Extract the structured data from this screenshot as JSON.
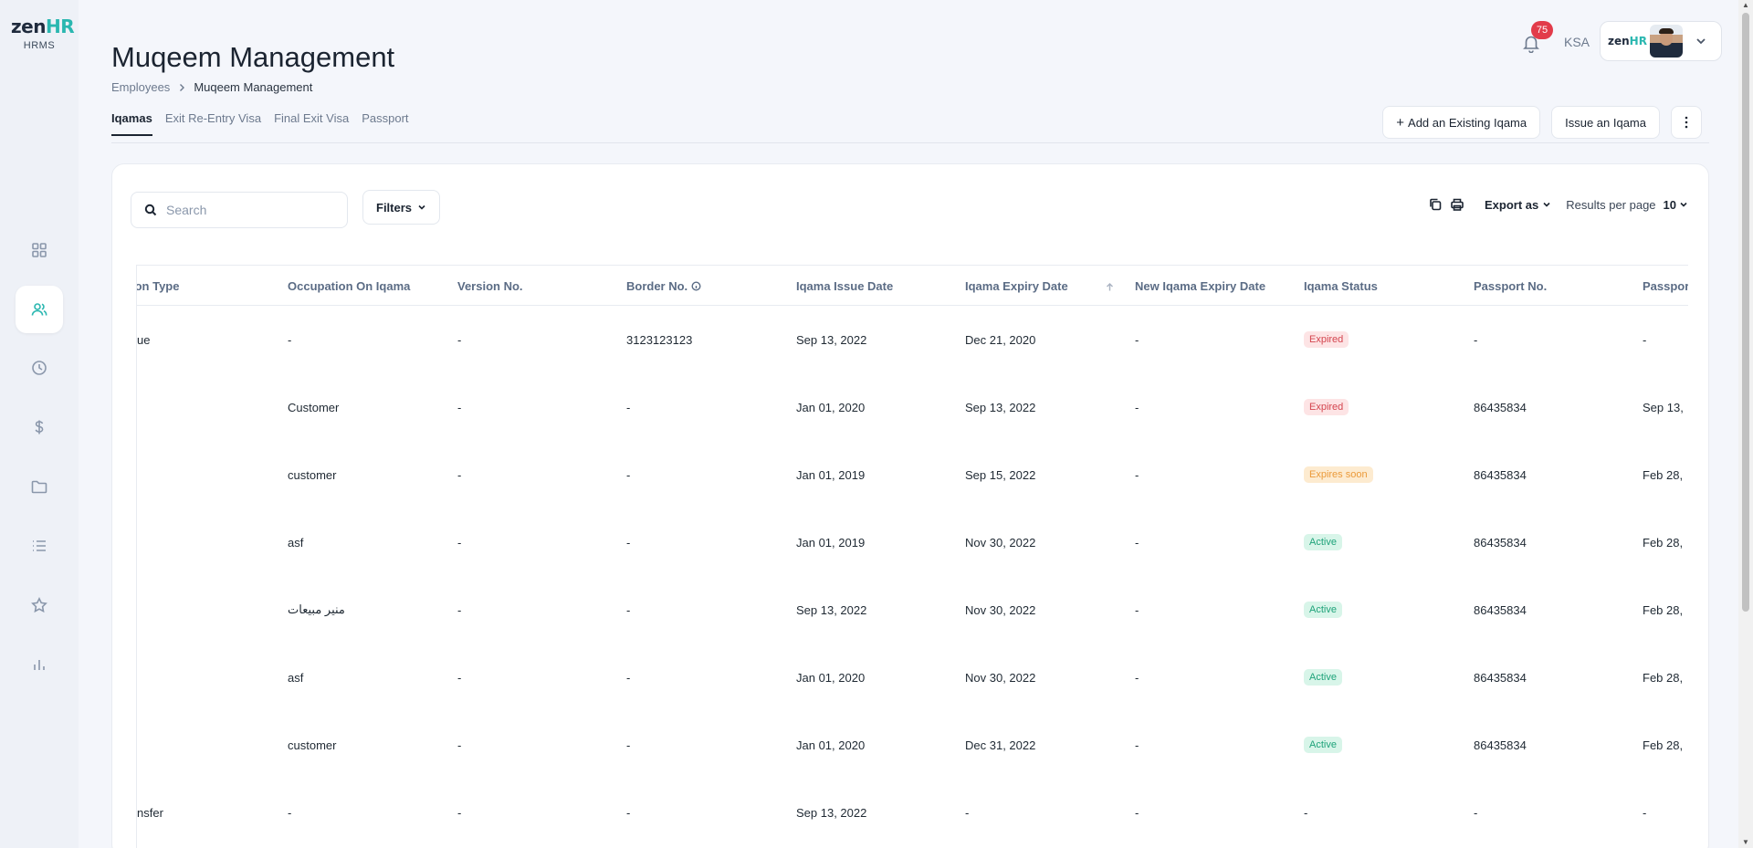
{
  "brand": {
    "logo_main": "zen",
    "logo_accent": "HR",
    "logo_sub": "HRMS",
    "accent_color": "#2ab7b0"
  },
  "sidebar": {
    "items": [
      {
        "icon": "dashboard-icon",
        "active": false
      },
      {
        "icon": "users-icon",
        "active": true
      },
      {
        "icon": "clock-icon",
        "active": false
      },
      {
        "icon": "dollar-icon",
        "active": false
      },
      {
        "icon": "folder-icon",
        "active": false
      },
      {
        "icon": "list-icon",
        "active": false
      },
      {
        "icon": "star-icon",
        "active": false
      },
      {
        "icon": "bar-chart-icon",
        "active": false
      }
    ]
  },
  "header": {
    "title": "Muqeem Management",
    "breadcrumb": {
      "parent": "Employees",
      "current": "Muqeem Management"
    },
    "notifications_count": "75",
    "region": "KSA",
    "profile_logo_main": "zen",
    "profile_logo_accent": "HR"
  },
  "tabs": [
    "Iqamas",
    "Exit Re-Entry Visa",
    "Final Exit Visa",
    "Passport"
  ],
  "actions": {
    "add_existing": "Add an Existing Iqama",
    "add_plus": "+",
    "issue": "Issue an Iqama"
  },
  "toolbar": {
    "search_placeholder": "Search",
    "filters_label": "Filters",
    "export_label": "Export as",
    "results_per_page_label": "Results per page",
    "results_per_page_value": "10"
  },
  "table": {
    "columns": [
      "ion Type",
      "Occupation On Iqama",
      "Version No.",
      "Border No.",
      "Iqama Issue Date",
      "Iqama Expiry Date",
      "New Iqama Expiry Date",
      "Iqama Status",
      "Passport No.",
      "Passpor"
    ],
    "rows": [
      [
        "ue",
        "-",
        "-",
        "3123123123",
        "Sep 13, 2022",
        "Dec 21, 2020",
        "-",
        "Expired",
        "-",
        "-"
      ],
      [
        "",
        "Customer",
        "-",
        "-",
        "Jan 01, 2020",
        "Sep 13, 2022",
        "-",
        "Expired",
        "86435834",
        "Sep 13,"
      ],
      [
        "",
        "customer",
        "-",
        "-",
        "Jan 01, 2019",
        "Sep 15, 2022",
        "-",
        "Expires soon",
        "86435834",
        "Feb 28,"
      ],
      [
        "",
        "asf",
        "-",
        "-",
        "Jan 01, 2019",
        "Nov 30, 2022",
        "-",
        "Active",
        "86435834",
        "Feb 28,"
      ],
      [
        "",
        "منير مبيعات",
        "-",
        "-",
        "Sep 13, 2022",
        "Nov 30, 2022",
        "-",
        "Active",
        "86435834",
        "Feb 28,"
      ],
      [
        "",
        "asf",
        "-",
        "-",
        "Jan 01, 2020",
        "Nov 30, 2022",
        "-",
        "Active",
        "86435834",
        "Feb 28,"
      ],
      [
        "",
        "customer",
        "-",
        "-",
        "Jan 01, 2020",
        "Dec 31, 2022",
        "-",
        "Active",
        "86435834",
        "Feb 28,"
      ],
      [
        "nsfer",
        "-",
        "-",
        "-",
        "Sep 13, 2022",
        "-",
        "-",
        "-",
        "-",
        "-"
      ]
    ],
    "status_colors": {
      "Expired": "#d4454f",
      "Expires soon": "#eb9a3a",
      "Active": "#1fa37a"
    }
  }
}
